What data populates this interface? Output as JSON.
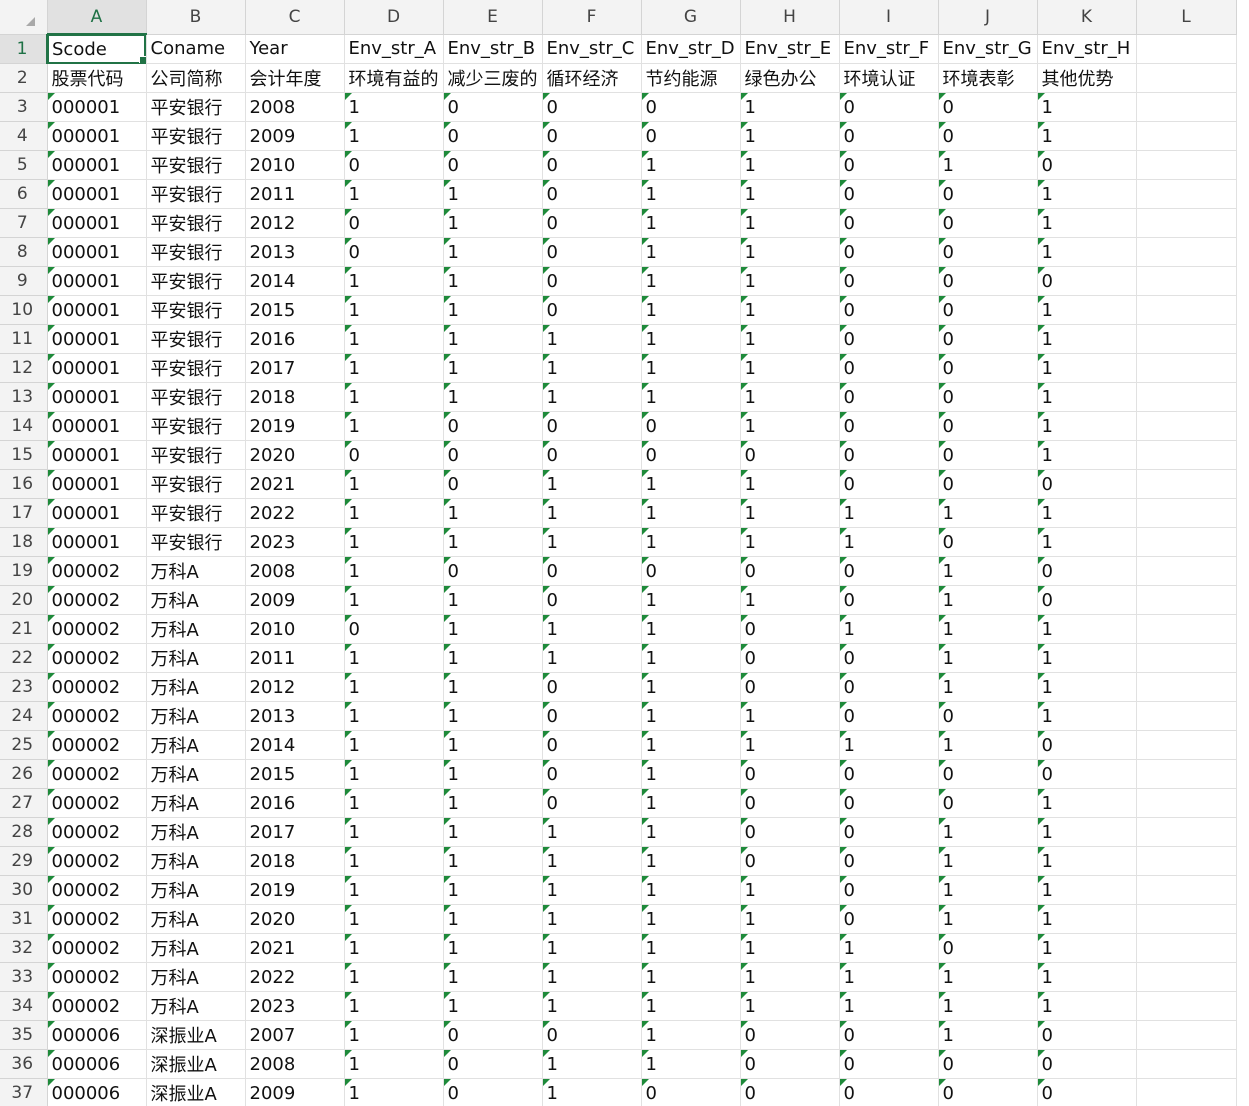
{
  "columns": [
    "A",
    "B",
    "C",
    "D",
    "E",
    "F",
    "G",
    "H",
    "I",
    "J",
    "K",
    "L"
  ],
  "active_cell": {
    "row": 1,
    "col": "A"
  },
  "rows": [
    {
      "n": "1",
      "cells": [
        "Scode",
        "Coname",
        "Year",
        "Env_str_A",
        "Env_str_B",
        "Env_str_C",
        "Env_str_D",
        "Env_str_E",
        "Env_str_F",
        "Env_str_G",
        "Env_str_H",
        ""
      ]
    },
    {
      "n": "2",
      "cells": [
        "股票代码",
        "公司简称",
        "会计年度",
        "环境有益的",
        "减少三废的",
        "循环经济",
        "节约能源",
        "绿色办公",
        "环境认证",
        "环境表彰",
        "其他优势",
        ""
      ]
    },
    {
      "n": "3",
      "cells": [
        "000001",
        "平安银行",
        "2008",
        "1",
        "0",
        "0",
        "0",
        "1",
        "0",
        "0",
        "1",
        ""
      ]
    },
    {
      "n": "4",
      "cells": [
        "000001",
        "平安银行",
        "2009",
        "1",
        "0",
        "0",
        "0",
        "1",
        "0",
        "0",
        "1",
        ""
      ]
    },
    {
      "n": "5",
      "cells": [
        "000001",
        "平安银行",
        "2010",
        "0",
        "0",
        "0",
        "1",
        "1",
        "0",
        "1",
        "0",
        ""
      ]
    },
    {
      "n": "6",
      "cells": [
        "000001",
        "平安银行",
        "2011",
        "1",
        "1",
        "0",
        "1",
        "1",
        "0",
        "0",
        "1",
        ""
      ]
    },
    {
      "n": "7",
      "cells": [
        "000001",
        "平安银行",
        "2012",
        "0",
        "1",
        "0",
        "1",
        "1",
        "0",
        "0",
        "1",
        ""
      ]
    },
    {
      "n": "8",
      "cells": [
        "000001",
        "平安银行",
        "2013",
        "0",
        "1",
        "0",
        "1",
        "1",
        "0",
        "0",
        "1",
        ""
      ]
    },
    {
      "n": "9",
      "cells": [
        "000001",
        "平安银行",
        "2014",
        "1",
        "1",
        "0",
        "1",
        "1",
        "0",
        "0",
        "0",
        ""
      ]
    },
    {
      "n": "10",
      "cells": [
        "000001",
        "平安银行",
        "2015",
        "1",
        "1",
        "0",
        "1",
        "1",
        "0",
        "0",
        "1",
        ""
      ]
    },
    {
      "n": "11",
      "cells": [
        "000001",
        "平安银行",
        "2016",
        "1",
        "1",
        "1",
        "1",
        "1",
        "0",
        "0",
        "1",
        ""
      ]
    },
    {
      "n": "12",
      "cells": [
        "000001",
        "平安银行",
        "2017",
        "1",
        "1",
        "1",
        "1",
        "1",
        "0",
        "0",
        "1",
        ""
      ]
    },
    {
      "n": "13",
      "cells": [
        "000001",
        "平安银行",
        "2018",
        "1",
        "1",
        "1",
        "1",
        "1",
        "0",
        "0",
        "1",
        ""
      ]
    },
    {
      "n": "14",
      "cells": [
        "000001",
        "平安银行",
        "2019",
        "1",
        "0",
        "0",
        "0",
        "1",
        "0",
        "0",
        "1",
        ""
      ]
    },
    {
      "n": "15",
      "cells": [
        "000001",
        "平安银行",
        "2020",
        "0",
        "0",
        "0",
        "0",
        "0",
        "0",
        "0",
        "1",
        ""
      ]
    },
    {
      "n": "16",
      "cells": [
        "000001",
        "平安银行",
        "2021",
        "1",
        "0",
        "1",
        "1",
        "1",
        "0",
        "0",
        "0",
        ""
      ]
    },
    {
      "n": "17",
      "cells": [
        "000001",
        "平安银行",
        "2022",
        "1",
        "1",
        "1",
        "1",
        "1",
        "1",
        "1",
        "1",
        ""
      ]
    },
    {
      "n": "18",
      "cells": [
        "000001",
        "平安银行",
        "2023",
        "1",
        "1",
        "1",
        "1",
        "1",
        "1",
        "0",
        "1",
        ""
      ]
    },
    {
      "n": "19",
      "cells": [
        "000002",
        "万科A",
        "2008",
        "1",
        "0",
        "0",
        "0",
        "0",
        "0",
        "1",
        "0",
        ""
      ]
    },
    {
      "n": "20",
      "cells": [
        "000002",
        "万科A",
        "2009",
        "1",
        "1",
        "0",
        "1",
        "1",
        "0",
        "1",
        "0",
        ""
      ]
    },
    {
      "n": "21",
      "cells": [
        "000002",
        "万科A",
        "2010",
        "0",
        "1",
        "1",
        "1",
        "0",
        "1",
        "1",
        "1",
        ""
      ]
    },
    {
      "n": "22",
      "cells": [
        "000002",
        "万科A",
        "2011",
        "1",
        "1",
        "1",
        "1",
        "0",
        "0",
        "1",
        "1",
        ""
      ]
    },
    {
      "n": "23",
      "cells": [
        "000002",
        "万科A",
        "2012",
        "1",
        "1",
        "0",
        "1",
        "0",
        "0",
        "1",
        "1",
        ""
      ]
    },
    {
      "n": "24",
      "cells": [
        "000002",
        "万科A",
        "2013",
        "1",
        "1",
        "0",
        "1",
        "1",
        "0",
        "0",
        "1",
        ""
      ]
    },
    {
      "n": "25",
      "cells": [
        "000002",
        "万科A",
        "2014",
        "1",
        "1",
        "0",
        "1",
        "1",
        "1",
        "1",
        "0",
        ""
      ]
    },
    {
      "n": "26",
      "cells": [
        "000002",
        "万科A",
        "2015",
        "1",
        "1",
        "0",
        "1",
        "0",
        "0",
        "0",
        "0",
        ""
      ]
    },
    {
      "n": "27",
      "cells": [
        "000002",
        "万科A",
        "2016",
        "1",
        "1",
        "0",
        "1",
        "0",
        "0",
        "0",
        "1",
        ""
      ]
    },
    {
      "n": "28",
      "cells": [
        "000002",
        "万科A",
        "2017",
        "1",
        "1",
        "1",
        "1",
        "0",
        "0",
        "1",
        "1",
        ""
      ]
    },
    {
      "n": "29",
      "cells": [
        "000002",
        "万科A",
        "2018",
        "1",
        "1",
        "1",
        "1",
        "0",
        "0",
        "1",
        "1",
        ""
      ]
    },
    {
      "n": "30",
      "cells": [
        "000002",
        "万科A",
        "2019",
        "1",
        "1",
        "1",
        "1",
        "1",
        "0",
        "1",
        "1",
        ""
      ]
    },
    {
      "n": "31",
      "cells": [
        "000002",
        "万科A",
        "2020",
        "1",
        "1",
        "1",
        "1",
        "1",
        "0",
        "1",
        "1",
        ""
      ]
    },
    {
      "n": "32",
      "cells": [
        "000002",
        "万科A",
        "2021",
        "1",
        "1",
        "1",
        "1",
        "1",
        "1",
        "0",
        "1",
        ""
      ]
    },
    {
      "n": "33",
      "cells": [
        "000002",
        "万科A",
        "2022",
        "1",
        "1",
        "1",
        "1",
        "1",
        "1",
        "1",
        "1",
        ""
      ]
    },
    {
      "n": "34",
      "cells": [
        "000002",
        "万科A",
        "2023",
        "1",
        "1",
        "1",
        "1",
        "1",
        "1",
        "1",
        "1",
        ""
      ]
    },
    {
      "n": "35",
      "cells": [
        "000006",
        "深振业A",
        "2007",
        "1",
        "0",
        "0",
        "1",
        "0",
        "0",
        "1",
        "0",
        ""
      ]
    },
    {
      "n": "36",
      "cells": [
        "000006",
        "深振业A",
        "2008",
        "1",
        "0",
        "1",
        "1",
        "0",
        "0",
        "0",
        "0",
        ""
      ]
    },
    {
      "n": "37",
      "cells": [
        "000006",
        "深振业A",
        "2009",
        "1",
        "0",
        "1",
        "0",
        "0",
        "0",
        "0",
        "0",
        ""
      ]
    }
  ]
}
